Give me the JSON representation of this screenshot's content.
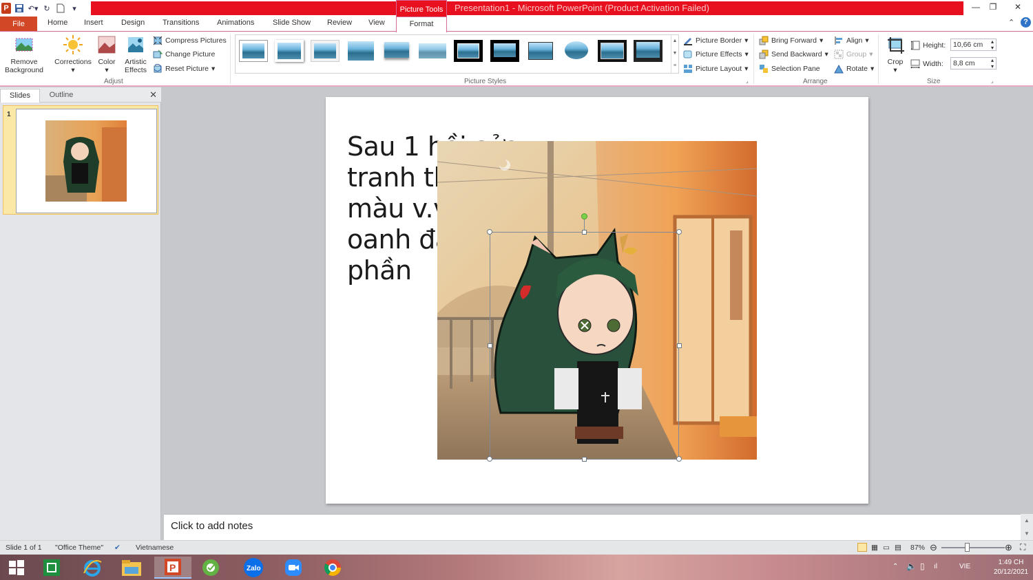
{
  "window": {
    "title": "Presentation1  -  Microsoft PowerPoint (Product Activation Failed)",
    "context_tab": "Picture Tools"
  },
  "tabs": [
    "File",
    "Home",
    "Insert",
    "Design",
    "Transitions",
    "Animations",
    "Slide Show",
    "Review",
    "View",
    "Format"
  ],
  "ribbon": {
    "adjust": {
      "label": "Adjust",
      "remove_background": "Remove Background",
      "corrections": "Corrections",
      "color": "Color",
      "artistic_effects": "Artistic Effects",
      "compress": "Compress Pictures",
      "change": "Change Picture",
      "reset": "Reset Picture"
    },
    "styles": {
      "label": "Picture Styles",
      "picture_border": "Picture Border",
      "picture_effects": "Picture Effects",
      "picture_layout": "Picture Layout"
    },
    "arrange": {
      "label": "Arrange",
      "bring_forward": "Bring Forward",
      "send_backward": "Send Backward",
      "selection_pane": "Selection Pane",
      "align": "Align",
      "group": "Group",
      "rotate": "Rotate"
    },
    "size": {
      "label": "Size",
      "crop": "Crop",
      "height_label": "Height:",
      "height_value": "10,66 cm",
      "width_label": "Width:",
      "width_value": "8,8 cm"
    }
  },
  "panel": {
    "tab_slides": "Slides",
    "tab_outline": "Outline",
    "slide_number": "1"
  },
  "slide": {
    "text": "Sau 1 hồi sửa tranh thêm màu v.v thì oanh đã xong 1 phần"
  },
  "notes": {
    "placeholder": "Click to add notes"
  },
  "status": {
    "slide_of": "Slide 1 of 1",
    "theme": "\"Office Theme\"",
    "language": "Vietnamese",
    "zoom": "87%"
  },
  "tray": {
    "lang": "VIE",
    "time": "1:49 CH",
    "date": "20/12/2021"
  },
  "colors": {
    "title_red": "#e8101e",
    "file_tab": "#d24726",
    "accent_pink": "#d46b96"
  }
}
